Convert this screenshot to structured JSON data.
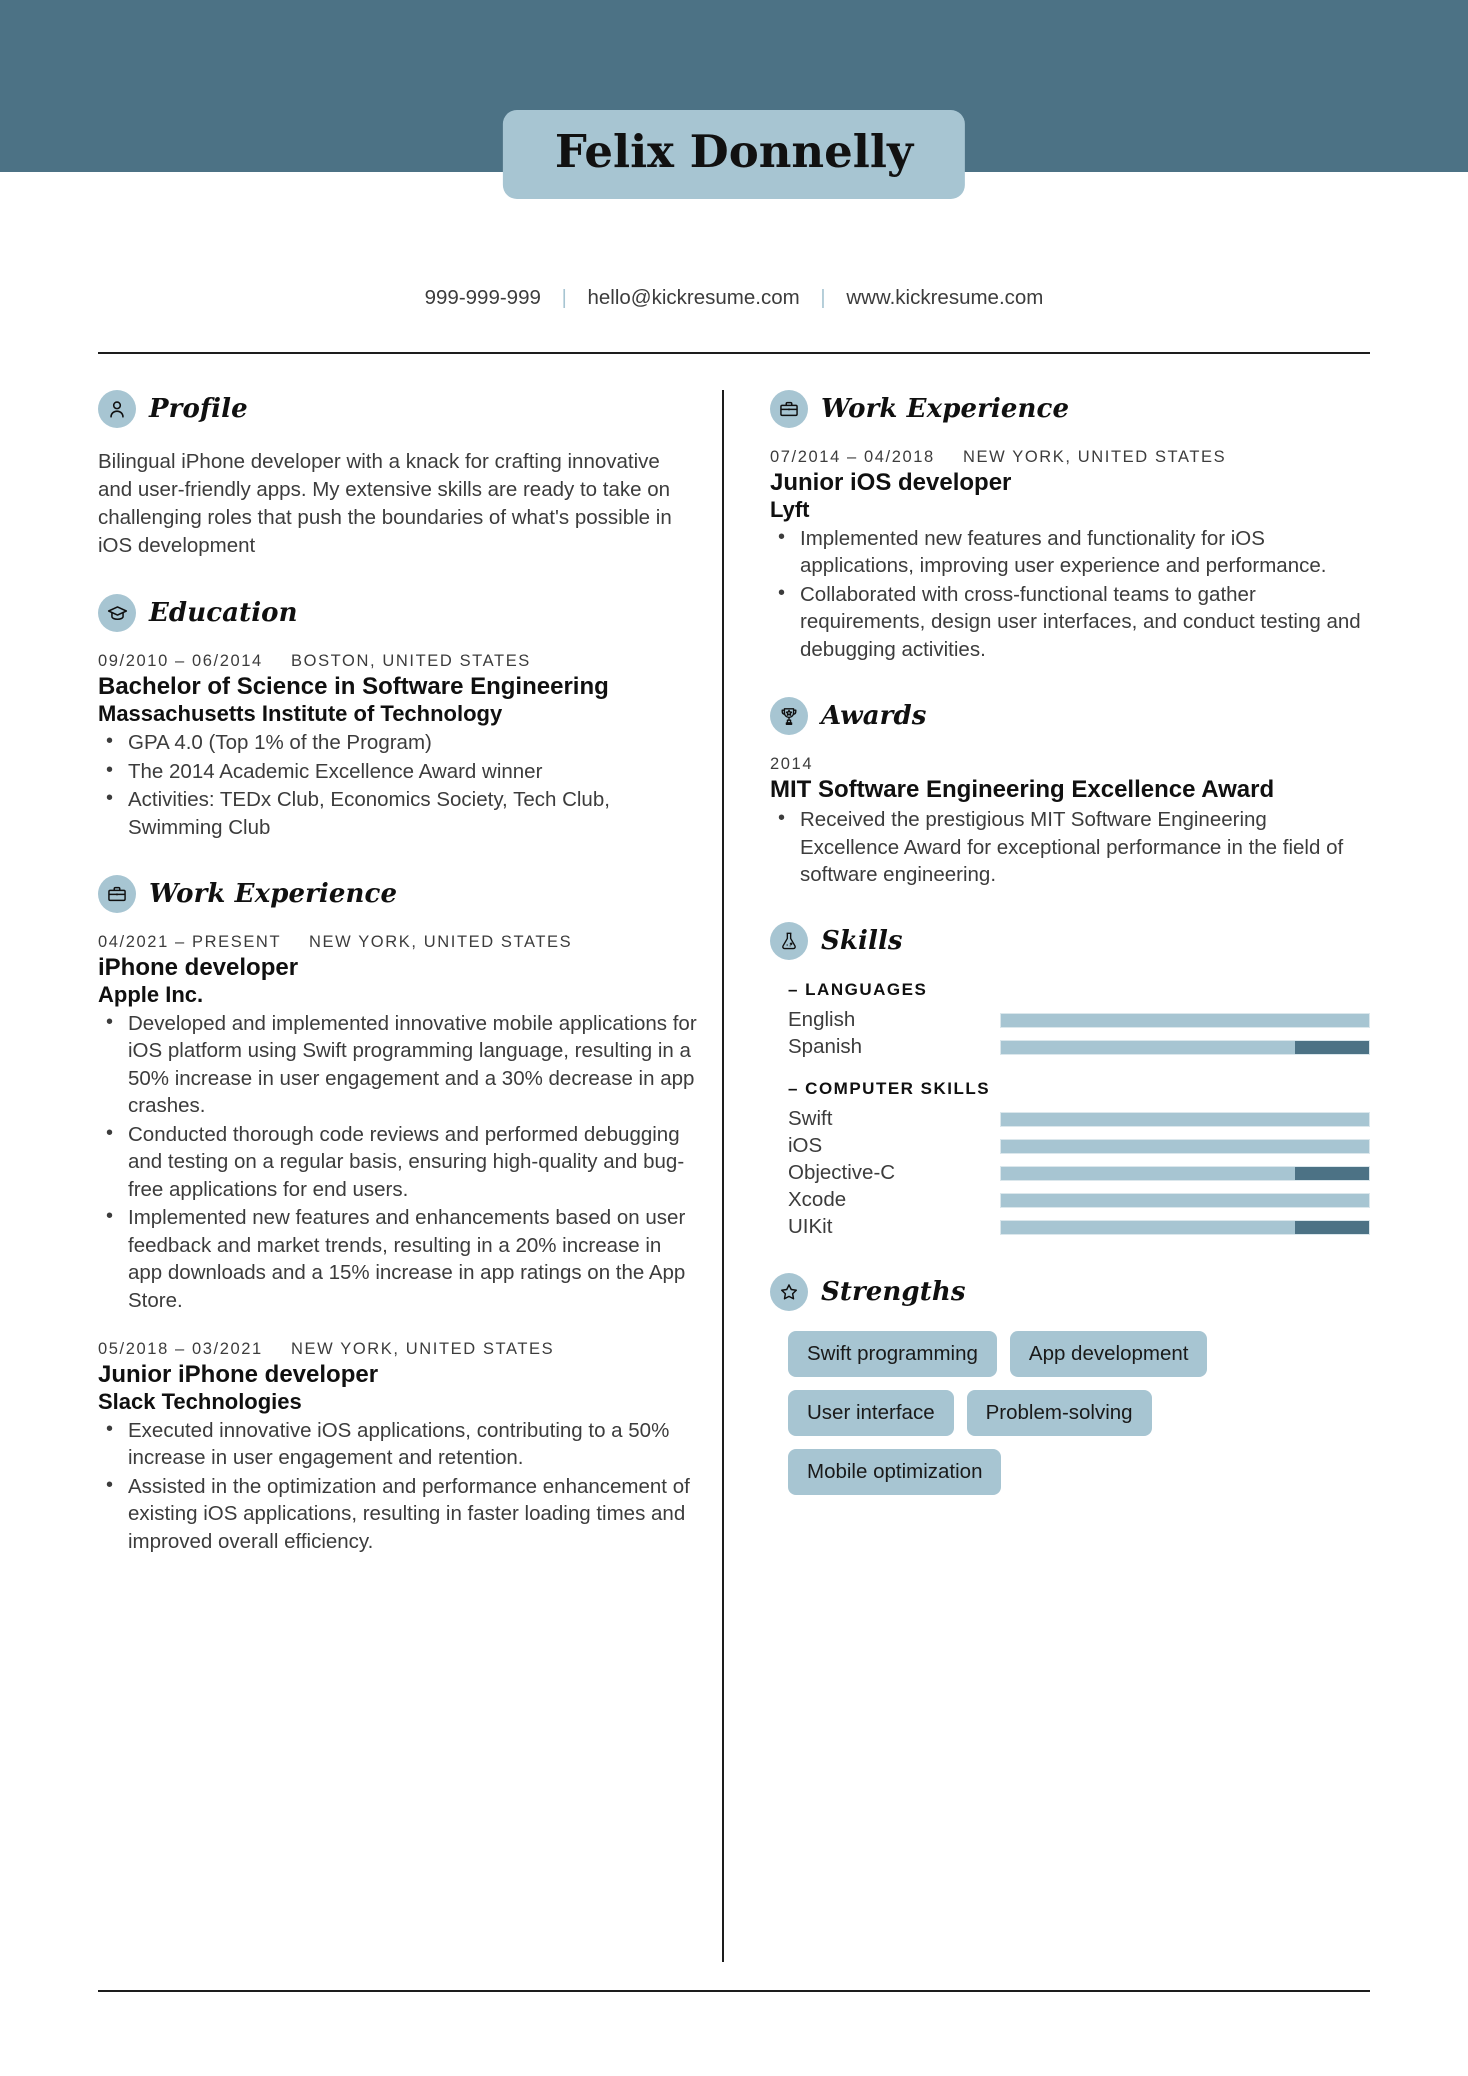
{
  "colors": {
    "band": "#4c7285",
    "accent": "#a7c5d2",
    "text": "#3c3c3c"
  },
  "header": {
    "name": "Felix Donnelly",
    "contact": {
      "phone": "999-999-999",
      "email": "hello@kickresume.com",
      "website": "www.kickresume.com",
      "separator": "|"
    }
  },
  "left_column": {
    "profile": {
      "heading": "Profile",
      "icon": "person-icon",
      "text": "Bilingual iPhone developer with a knack for crafting innovative and user-friendly apps. My extensive skills are ready to take on challenging roles that push the boundaries of what's possible in iOS development"
    },
    "education": {
      "heading": "Education",
      "icon": "graduation-cap-icon",
      "entries": [
        {
          "dates": "09/2010 – 06/2014",
          "location": "BOSTON, UNITED STATES",
          "title": "Bachelor of Science in Software Engineering",
          "organization": "Massachusetts Institute of Technology",
          "bullets": [
            "GPA 4.0 (Top 1% of the Program)",
            "The 2014 Academic Excellence Award winner",
            "Activities: TEDx Club, Economics Society, Tech Club, Swimming Club"
          ]
        }
      ]
    },
    "work_experience": {
      "heading": "Work Experience",
      "icon": "briefcase-icon",
      "entries": [
        {
          "dates": "04/2021 – PRESENT",
          "location": "NEW YORK, UNITED STATES",
          "title": "iPhone developer",
          "organization": "Apple Inc.",
          "bullets": [
            "Developed and implemented innovative mobile applications for iOS platform using Swift programming language, resulting in a 50% increase in user engagement and a 30% decrease in app crashes.",
            "Conducted thorough code reviews and performed debugging and testing on a regular basis, ensuring high-quality and bug-free applications for end users.",
            "Implemented new features and enhancements based on user feedback and market trends, resulting in a 20% increase in app downloads and a 15% increase in app ratings on the App Store."
          ]
        },
        {
          "dates": "05/2018 – 03/2021",
          "location": "NEW YORK, UNITED STATES",
          "title": "Junior iPhone developer",
          "organization": "Slack Technologies",
          "bullets": [
            "Executed innovative iOS applications, contributing to a 50% increase in user engagement and retention.",
            "Assisted in the optimization and performance enhancement of existing iOS applications, resulting in faster loading times and improved overall efficiency."
          ]
        }
      ]
    }
  },
  "right_column": {
    "work_experience": {
      "heading": "Work Experience",
      "icon": "briefcase-icon",
      "entries": [
        {
          "dates": "07/2014 – 04/2018",
          "location": "NEW YORK, UNITED STATES",
          "title": "Junior iOS developer",
          "organization": "Lyft",
          "bullets": [
            "Implemented new features and functionality for iOS applications, improving user experience and performance.",
            "Collaborated with cross-functional teams to gather requirements, design user interfaces, and conduct testing and debugging activities."
          ]
        }
      ]
    },
    "awards": {
      "heading": "Awards",
      "icon": "trophy-icon",
      "entries": [
        {
          "dates": "2014",
          "location": "",
          "title": "MIT Software Engineering Excellence Award",
          "organization": "",
          "bullets": [
            "Received the prestigious MIT Software Engineering Excellence Award for exceptional performance in the field of software engineering."
          ]
        }
      ]
    },
    "skills": {
      "heading": "Skills",
      "icon": "flask-icon",
      "groups": [
        {
          "label": "– LANGUAGES",
          "items": [
            {
              "name": "English",
              "level": 100
            },
            {
              "name": "Spanish",
              "level": 80
            }
          ]
        },
        {
          "label": "– COMPUTER SKILLS",
          "items": [
            {
              "name": "Swift",
              "level": 100
            },
            {
              "name": "iOS",
              "level": 100
            },
            {
              "name": "Objective-C",
              "level": 80
            },
            {
              "name": "Xcode",
              "level": 100
            },
            {
              "name": "UIKit",
              "level": 80
            }
          ]
        }
      ]
    },
    "strengths": {
      "heading": "Strengths",
      "icon": "star-icon",
      "tags": [
        "Swift programming",
        "App development",
        "User interface",
        "Problem-solving",
        "Mobile optimization"
      ]
    }
  }
}
